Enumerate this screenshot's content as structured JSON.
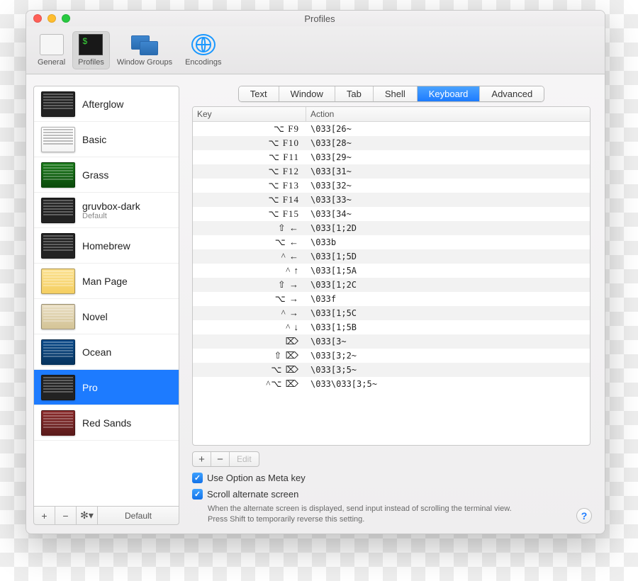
{
  "window": {
    "title": "Profiles"
  },
  "toolbar": {
    "items": [
      {
        "label": "General"
      },
      {
        "label": "Profiles"
      },
      {
        "label": "Window Groups"
      },
      {
        "label": "Encodings"
      }
    ]
  },
  "sidebar": {
    "profiles": [
      {
        "name": "Afterglow",
        "thumb": "dark"
      },
      {
        "name": "Basic",
        "thumb": "light"
      },
      {
        "name": "Grass",
        "thumb": "green"
      },
      {
        "name": "gruvbox-dark",
        "sub": "Default",
        "thumb": "dark"
      },
      {
        "name": "Homebrew",
        "thumb": "dark"
      },
      {
        "name": "Man Page",
        "thumb": "yellow"
      },
      {
        "name": "Novel",
        "thumb": "tan"
      },
      {
        "name": "Ocean",
        "thumb": "blue"
      },
      {
        "name": "Pro",
        "thumb": "dark",
        "selected": true
      },
      {
        "name": "Red Sands",
        "thumb": "red"
      }
    ],
    "toolbar": {
      "add": "+",
      "remove": "−",
      "gear": "✻▾",
      "default": "Default"
    }
  },
  "tabs": [
    "Text",
    "Window",
    "Tab",
    "Shell",
    "Keyboard",
    "Advanced"
  ],
  "active_tab": "Keyboard",
  "keytable": {
    "headers": {
      "key": "Key",
      "action": "Action"
    },
    "rows": [
      {
        "key": "⌥ F9",
        "action": "\\033[26~"
      },
      {
        "key": "⌥ F10",
        "action": "\\033[28~"
      },
      {
        "key": "⌥ F11",
        "action": "\\033[29~"
      },
      {
        "key": "⌥ F12",
        "action": "\\033[31~"
      },
      {
        "key": "⌥ F13",
        "action": "\\033[32~"
      },
      {
        "key": "⌥ F14",
        "action": "\\033[33~"
      },
      {
        "key": "⌥ F15",
        "action": "\\033[34~"
      },
      {
        "key": "⇧ ←",
        "action": "\\033[1;2D"
      },
      {
        "key": "⌥ ←",
        "action": "\\033b"
      },
      {
        "key": "^ ←",
        "action": "\\033[1;5D"
      },
      {
        "key": "^ ↑",
        "action": "\\033[1;5A"
      },
      {
        "key": "⇧ →",
        "action": "\\033[1;2C"
      },
      {
        "key": "⌥ →",
        "action": "\\033f"
      },
      {
        "key": "^ →",
        "action": "\\033[1;5C"
      },
      {
        "key": "^ ↓",
        "action": "\\033[1;5B"
      },
      {
        "key": "⌦",
        "action": "\\033[3~"
      },
      {
        "key": "⇧ ⌦",
        "action": "\\033[3;2~"
      },
      {
        "key": "⌥ ⌦",
        "action": "\\033[3;5~"
      },
      {
        "key": "^⌥ ⌦",
        "action": "\\033\\033[3;5~"
      }
    ]
  },
  "table_toolbar": {
    "add": "+",
    "remove": "−",
    "edit": "Edit"
  },
  "checks": {
    "meta": "Use Option as Meta key",
    "scroll": "Scroll alternate screen"
  },
  "helptext": "When the alternate screen is displayed, send input instead of scrolling the terminal view. Press Shift to temporarily reverse this setting.",
  "help_btn": "?"
}
